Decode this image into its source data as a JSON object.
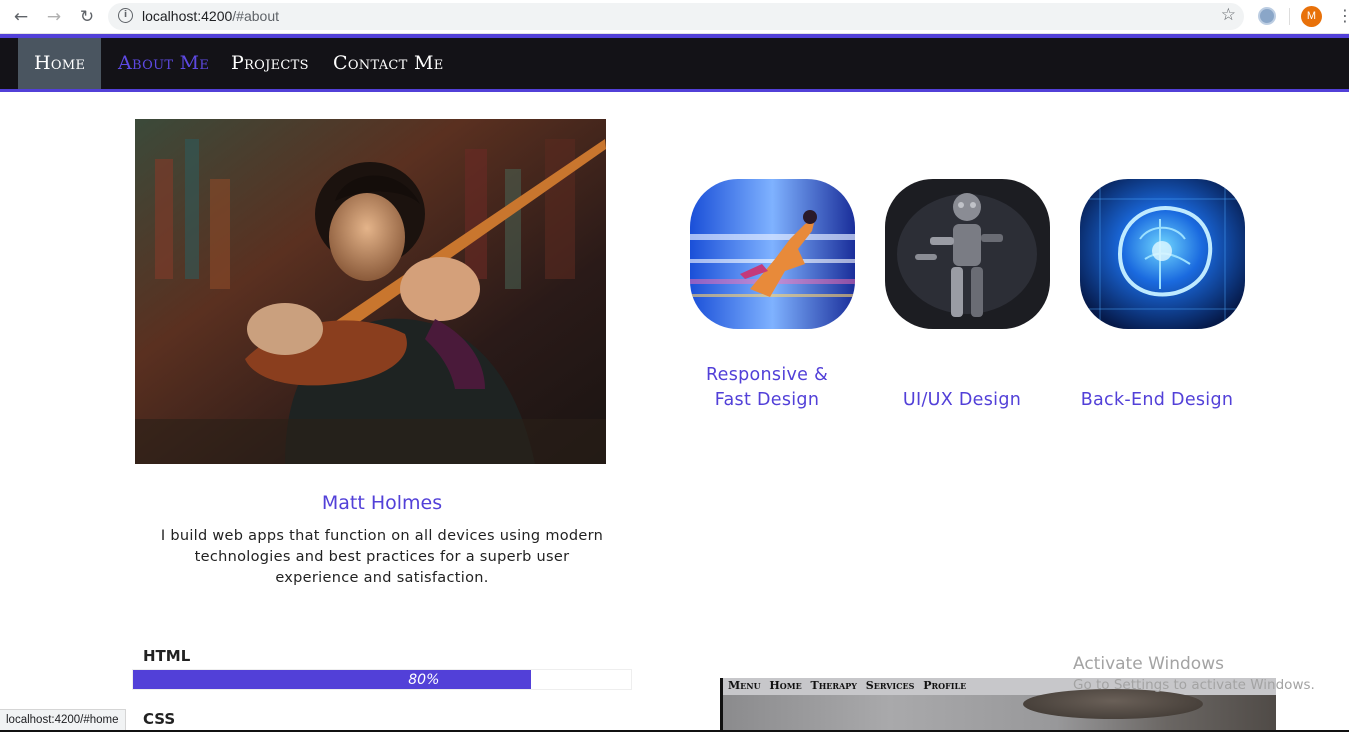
{
  "browser": {
    "url_host": "localhost:4200",
    "url_path": "/#about",
    "avatar_letter": "M",
    "status_url": "localhost:4200/#home"
  },
  "navbar": {
    "items": [
      {
        "label": "Home",
        "active": true
      },
      {
        "label": "About Me",
        "current": true
      },
      {
        "label": "Projects"
      },
      {
        "label": "Contact Me"
      }
    ],
    "accent": "#5240d8",
    "background": "#131217"
  },
  "profile": {
    "name": "Matt Holmes",
    "bio": "I build web apps that function on all devices using modern technologies and best practices for a superb user experience and satisfaction."
  },
  "skills": [
    {
      "label": "HTML",
      "percent": 80,
      "percent_label": "80%"
    },
    {
      "label": "CSS"
    }
  ],
  "services": [
    {
      "label_line1": "Responsive &",
      "label_line2": "Fast Design",
      "image": "runner-speed-image"
    },
    {
      "label_line1": "UI/UX Design",
      "image": "robot-image"
    },
    {
      "label_line1": "Back-End Design",
      "image": "digital-brain-image"
    }
  ],
  "project_preview": {
    "menu": "Menu Home Therapy Services Profile"
  },
  "watermark": {
    "title": "Activate Windows",
    "subtitle": "Go to Settings to activate Windows."
  }
}
